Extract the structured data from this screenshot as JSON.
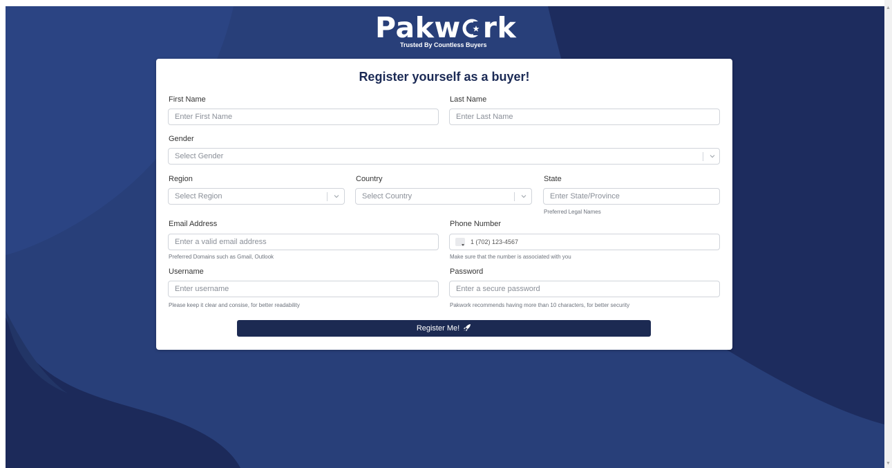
{
  "brand": {
    "name_left": "Pakw",
    "name_right": "rk",
    "tagline": "Trusted By Countless Buyers"
  },
  "form": {
    "title": "Register yourself as a buyer!",
    "first_name": {
      "label": "First Name",
      "placeholder": "Enter First Name"
    },
    "last_name": {
      "label": "Last Name",
      "placeholder": "Enter Last Name"
    },
    "gender": {
      "label": "Gender",
      "placeholder": "Select Gender"
    },
    "region": {
      "label": "Region",
      "placeholder": "Select Region"
    },
    "country": {
      "label": "Country",
      "placeholder": "Select Country"
    },
    "state": {
      "label": "State",
      "placeholder": "Enter State/Province",
      "hint": "Preferred Legal Names"
    },
    "email": {
      "label": "Email Address",
      "placeholder": "Enter a valid email address",
      "hint": "Preferred Domains such as Gmail, Outlook"
    },
    "phone": {
      "label": "Phone Number",
      "placeholder": "1 (702) 123-4567",
      "hint": "Make sure that the number is associated with you"
    },
    "username": {
      "label": "Username",
      "placeholder": "Enter username",
      "hint": "Please keep it clear and consise, for better readability"
    },
    "password": {
      "label": "Password",
      "placeholder": "Enter a secure password",
      "hint": "Pakwork recommends having more than 10 characters, for better security"
    },
    "submit_label": "Register Me!"
  },
  "colors": {
    "background": "#283f79",
    "background_dark": "#1d2c5e",
    "button": "#1c2a52",
    "title": "#1b2a55"
  },
  "icons": {
    "logo_o": "crescent-star-icon",
    "submit": "rocket-icon",
    "select": "chevron-down-icon"
  }
}
